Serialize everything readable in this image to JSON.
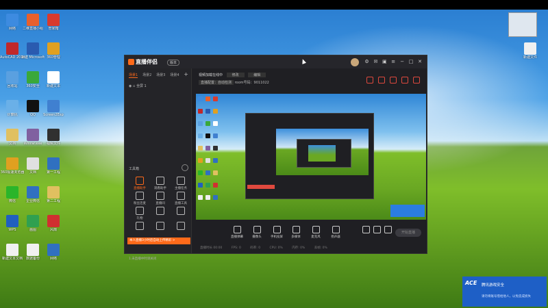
{
  "desktop_icons": [
    {
      "label": "网络",
      "color": "#3d8be0"
    },
    {
      "label": "二维直播小组",
      "color": "#e8602c"
    },
    {
      "label": "管家箱",
      "color": "#d83a2e"
    },
    {
      "label": "AutoCAD 2014 - 简",
      "color": "#c0282a"
    },
    {
      "label": "新建 Microsoft",
      "color": "#2a5bb0"
    },
    {
      "label": "360管理",
      "color": "#e0a020"
    },
    {
      "label": "回收站",
      "color": "#5aa0e0"
    },
    {
      "label": "360安全",
      "color": "#3aa83a"
    },
    {
      "label": "新建文本",
      "color": "#ffffff"
    },
    {
      "label": "计算机",
      "color": "#6ab0e8"
    },
    {
      "label": "QQ",
      "color": "#111111"
    },
    {
      "label": "Screen2Exp",
      "color": "#4080d0"
    },
    {
      "label": "文档",
      "color": "#e0c060"
    },
    {
      "label": "Winrar.exe",
      "color": "#8060a0"
    },
    {
      "label": "视频文件",
      "color": "#303030"
    },
    {
      "label": "360极速浏览器",
      "color": "#e0a020"
    },
    {
      "label": "文档",
      "color": "#e0e0e0"
    },
    {
      "label": "第一工程",
      "color": "#3070c0"
    },
    {
      "label": "微信",
      "color": "#2ab52a"
    },
    {
      "label": "企业微信",
      "color": "#3070c0"
    },
    {
      "label": "第二工程",
      "color": "#e0c060"
    },
    {
      "label": "WPS",
      "color": "#2060c0"
    },
    {
      "label": "画图",
      "color": "#30a050"
    },
    {
      "label": "风扇",
      "color": "#d03030"
    },
    {
      "label": "新建文本文档",
      "color": "#f0f0f0"
    },
    {
      "label": "数据备份",
      "color": "#f0f0f0"
    },
    {
      "label": "网络",
      "color": "#3070c0"
    }
  ],
  "top_right_icon": {
    "label": "截图"
  },
  "right_icon": {
    "label": "新建文件"
  },
  "app": {
    "title": "直播伴侣",
    "version_badge": "版本",
    "sidebar": {
      "tabs": [
        "场景1",
        "场景2",
        "场景3",
        "场景4"
      ],
      "scene_label": "全屏 1",
      "tools_title": "工具箱",
      "tools": [
        {
          "label": "直播助手",
          "hot": true
        },
        {
          "label": "观看助手",
          "hot": false
        },
        {
          "label": "主播任务",
          "hot": false
        },
        {
          "label": "粉丝连麦",
          "hot": false
        },
        {
          "label": "直播间",
          "hot": false
        },
        {
          "label": "直播工具",
          "hot": false
        },
        {
          "label": "礼物",
          "hot": false
        },
        {
          "label": "",
          "hot": false
        },
        {
          "label": "",
          "hot": false
        },
        {
          "label": "",
          "hot": false
        },
        {
          "label": "",
          "hot": false
        },
        {
          "label": "",
          "hot": false
        }
      ],
      "promo": "本人直播3小时后自动上传精彩 >",
      "notice": "1.未直播中时请关闭"
    },
    "main": {
      "title_label": "视频加载在线中",
      "title_box1": "修改",
      "title_box2": "编辑",
      "stream_label": "直播配置：自动检测",
      "room_label": "room号码：9011022",
      "bottom_buttons": [
        "直播弹幕",
        "摄像头",
        "手机投屏",
        "多媒体",
        "麦克风",
        "扬声器"
      ],
      "go_live": "开始直播",
      "status": [
        "直播时长 00:00",
        "FPS: 0",
        "码率: 0",
        "CPU: 0%",
        "内存: 0%",
        "丢帧: 0%"
      ]
    }
  },
  "toast": {
    "logo": "ACE",
    "title": "腾讯游戏安全",
    "desc": "请勿将账号借给他人，以免造成损失"
  }
}
